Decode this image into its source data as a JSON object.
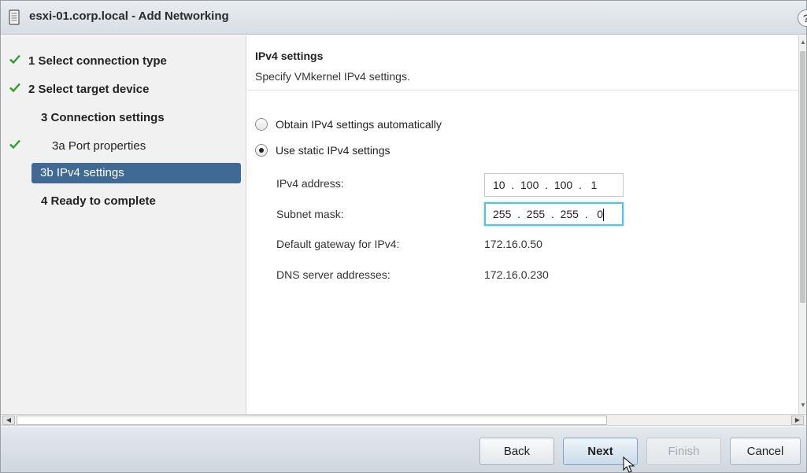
{
  "window": {
    "title": "esxi-01.corp.local - Add Networking",
    "help_label": "?"
  },
  "nav": {
    "steps": [
      {
        "label": "1  Select connection type",
        "completed": true,
        "active": false
      },
      {
        "label": "2  Select target device",
        "completed": true,
        "active": false
      },
      {
        "label": "3  Connection settings",
        "completed": false,
        "active": false
      },
      {
        "label": "3a  Port properties",
        "completed": true,
        "active": false
      },
      {
        "label": "3b  IPv4 settings",
        "completed": false,
        "active": true
      },
      {
        "label": "4  Ready to complete",
        "completed": false,
        "active": false
      }
    ]
  },
  "content": {
    "section_title": "IPv4 settings",
    "section_subtitle": "Specify VMkernel IPv4 settings.",
    "radio_auto_label": "Obtain IPv4 settings automatically",
    "radio_static_label": "Use static IPv4 settings",
    "selected_option": "static",
    "ipv4_address_label": "IPv4 address:",
    "ipv4_address_value": "10  .  100  .  100  .   1",
    "subnet_mask_label": "Subnet mask:",
    "subnet_mask_value": "255  .  255  .  255  .   0",
    "gateway_label": "Default gateway for IPv4:",
    "gateway_value": "172.16.0.50",
    "dns_label": "DNS server addresses:",
    "dns_value": "172.16.0.230"
  },
  "footer": {
    "back_label": "Back",
    "next_label": "Next",
    "finish_label": "Finish",
    "cancel_label": "Cancel"
  },
  "colors": {
    "check_green": "#2e9e2e",
    "active_step_bg": "#3e6a95",
    "focus_ring": "#55c6d6"
  },
  "icons": {
    "window_icon": "dialog-window-icon",
    "check_icon": "checkmark-icon",
    "cursor": "mouse-pointer-icon"
  }
}
